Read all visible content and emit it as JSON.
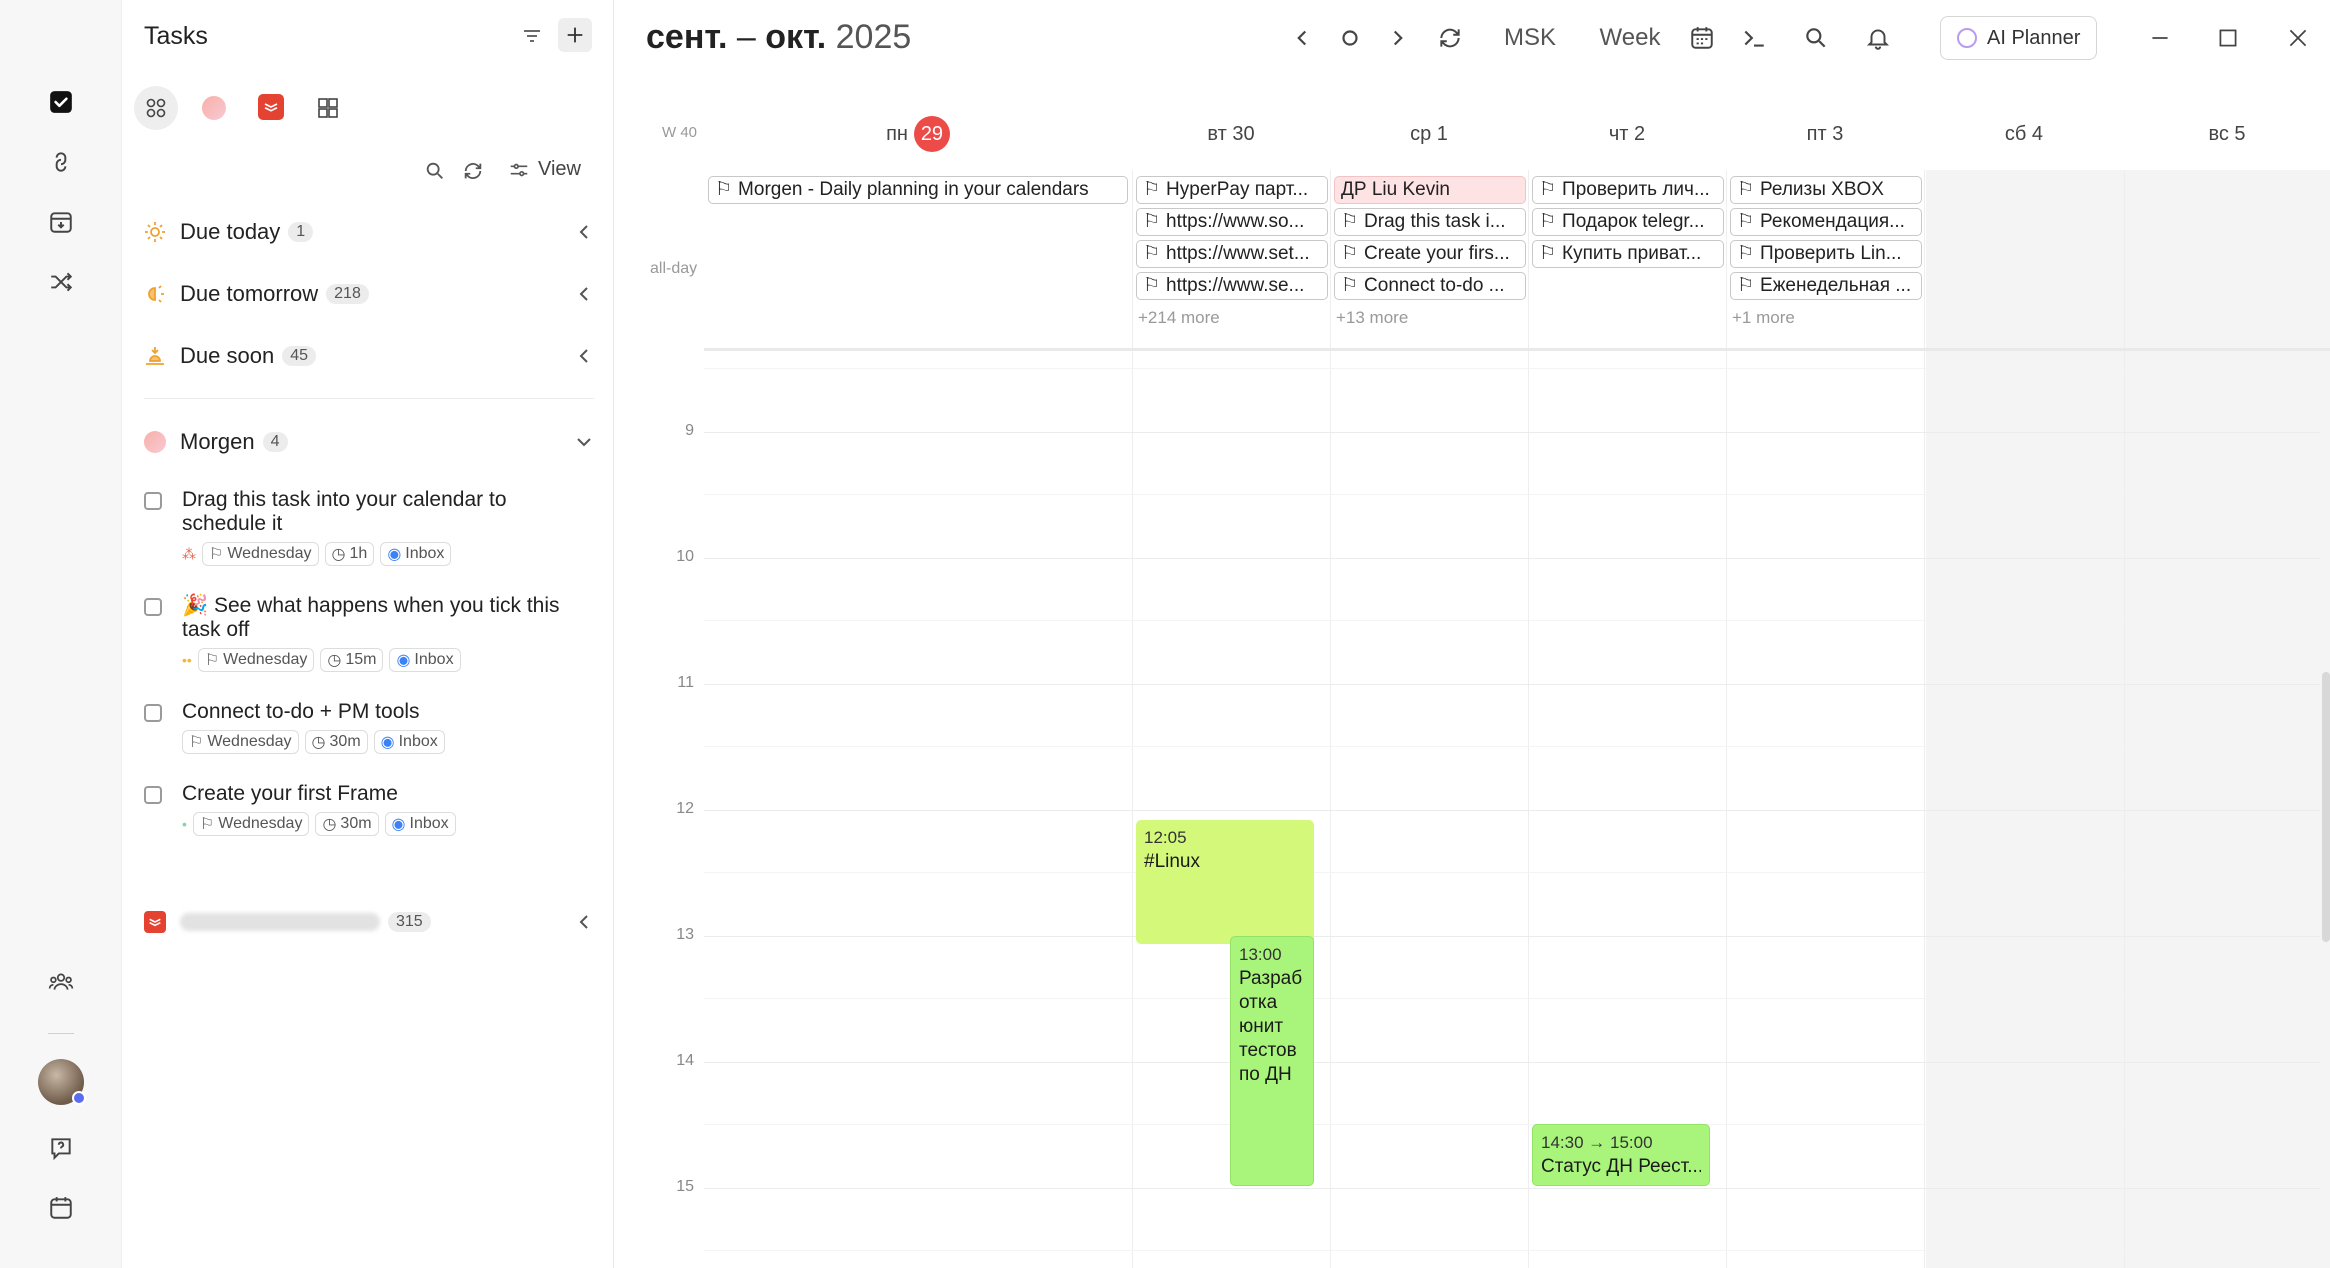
{
  "rail": {
    "icons": [
      "tasks-check-icon",
      "link-icon",
      "calendar-download-icon",
      "shuffle-icon",
      "people-icon",
      "help-icon",
      "calendar-icon"
    ]
  },
  "tasks_panel": {
    "title": "Tasks",
    "view_label": "View",
    "groups": [
      {
        "label": "Due today",
        "count": "1"
      },
      {
        "label": "Due tomorrow",
        "count": "218"
      },
      {
        "label": "Due soon",
        "count": "45"
      }
    ],
    "morgen": {
      "label": "Morgen",
      "count": "4"
    },
    "items": [
      {
        "title": "Drag this task into your calendar to schedule it",
        "day": "Wednesday",
        "duration": "1h",
        "list": "Inbox"
      },
      {
        "title": "🎉 See what happens when you tick this task off",
        "day": "Wednesday",
        "duration": "15m",
        "list": "Inbox"
      },
      {
        "title": "Connect to-do + PM tools",
        "day": "Wednesday",
        "duration": "30m",
        "list": "Inbox"
      },
      {
        "title": "Create your first Frame",
        "day": "Wednesday",
        "duration": "30m",
        "list": "Inbox"
      }
    ],
    "todoist": {
      "count": "315"
    }
  },
  "calendar": {
    "month_a": "сент.",
    "separator": " – ",
    "month_b": "окт.",
    "year": "2025",
    "timezone": "MSK",
    "view": "Week",
    "ai_planner": "AI Planner",
    "week_label": "W 40",
    "allday_label": "all-day",
    "days": [
      {
        "name": "пн",
        "num": "29"
      },
      {
        "name": "вт 30"
      },
      {
        "name": "ср 1"
      },
      {
        "name": "чт 2"
      },
      {
        "name": "пт 3"
      },
      {
        "name": "сб 4"
      },
      {
        "name": "вс 5"
      }
    ],
    "allday": {
      "mon": [
        "Morgen - Daily planning in your calendars"
      ],
      "tue": [
        "HyperPay парт...",
        "https://www.so...",
        "https://www.set...",
        "https://www.se..."
      ],
      "wed": [
        "ДР Liu Kevin",
        "Drag this task i...",
        "Create your firs...",
        "Connect to-do ..."
      ],
      "thu": [
        "Проверить лич...",
        "Подарок telegr...",
        "Купить приват..."
      ],
      "fri": [
        "Релизы XBOX",
        "Рекомендация...",
        "Проверить Lin...",
        "Еженедельная ..."
      ]
    },
    "more": {
      "tue": "+214 more",
      "wed": "+13 more",
      "fri": "+1 more"
    },
    "hours": [
      "9",
      "10",
      "11",
      "12",
      "13",
      "14",
      "15"
    ],
    "events": [
      {
        "time": "12:05",
        "title": "#Linux"
      },
      {
        "time": "13:00",
        "title": "Разраб отка юнит тестов по ДН"
      },
      {
        "time": "14:30 → 15:00",
        "title": "Статус ДН Реест..."
      }
    ]
  },
  "colors": {
    "accent_red": "#ec4b48",
    "event_yellow": "#d4f97a",
    "event_green": "#a9f47a",
    "pink_event": "#fde3e4"
  }
}
